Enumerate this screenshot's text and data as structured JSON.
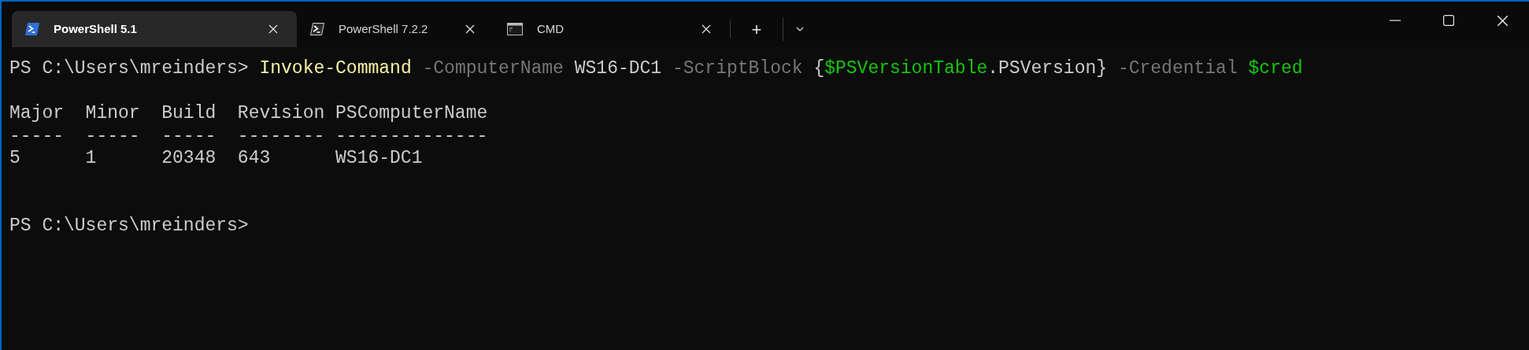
{
  "tabs": [
    {
      "kind": "powershell",
      "label": "PowerShell 5.1",
      "selected": true
    },
    {
      "kind": "pwsh",
      "label": "PowerShell 7.2.2",
      "selected": false
    },
    {
      "kind": "cmd",
      "label": "CMD",
      "selected": false
    }
  ],
  "new_tab": "+",
  "terminal": {
    "command": [
      {
        "kind": "prompt",
        "text": "PS C:\\Users\\mreinders> "
      },
      {
        "kind": "command",
        "text": "Invoke-Command"
      },
      {
        "kind": "parameter",
        "text": " -ComputerName"
      },
      {
        "kind": "argument",
        "text": " WS16-DC1"
      },
      {
        "kind": "parameter",
        "text": " -ScriptBlock"
      },
      {
        "kind": "argument",
        "text": " {"
      },
      {
        "kind": "variable",
        "text": "$PSVersionTable"
      },
      {
        "kind": "argument",
        "text": ".PSVersion}"
      },
      {
        "kind": "parameter",
        "text": " -Credential"
      },
      {
        "kind": "variable",
        "text": " $cred"
      }
    ],
    "table": {
      "columns": [
        {
          "header": "Major",
          "rule": "-----"
        },
        {
          "header": "Minor",
          "rule": "-----"
        },
        {
          "header": "Build",
          "rule": "-----"
        },
        {
          "header": "Revision",
          "rule": "--------"
        },
        {
          "header": "PSComputerName",
          "rule": "--------------"
        }
      ],
      "rows": [
        [
          "5",
          "1",
          "20348",
          "643",
          "WS16-DC1"
        ]
      ]
    },
    "prompt": "PS C:\\Users\\mreinders>"
  }
}
